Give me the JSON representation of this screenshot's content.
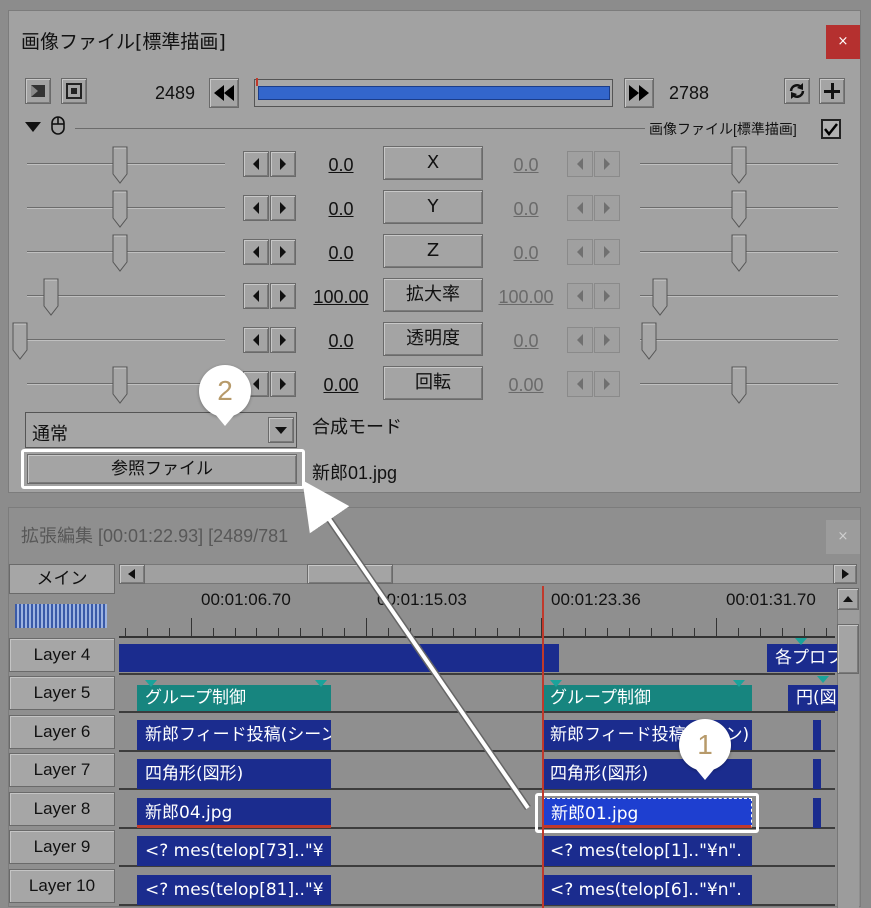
{
  "top_window": {
    "title": "画像ファイル[標準描画]",
    "close_label": "×",
    "frame_start": "2489",
    "frame_end": "2788",
    "object_label": "画像ファイル[標準描画]",
    "params": [
      {
        "name": "X",
        "value": "0.0",
        "end_value": "0.0"
      },
      {
        "name": "Y",
        "value": "0.0",
        "end_value": "0.0"
      },
      {
        "name": "Z",
        "value": "0.0",
        "end_value": "0.0"
      },
      {
        "name": "拡大率",
        "value": "100.00",
        "end_value": "100.00"
      },
      {
        "name": "透明度",
        "value": "0.0",
        "end_value": "0.0"
      },
      {
        "name": "回転",
        "value": "0.00",
        "end_value": "0.00"
      }
    ],
    "blend_mode_value": "通常",
    "blend_mode_label": "合成モード",
    "browse_button": "参照ファイル",
    "file_name": "新郎01.jpg"
  },
  "bottom_window": {
    "title": "拡張編集 [00:01:22.93] [2489/781",
    "close_label": "×",
    "scene_button": "メイン",
    "timestamps": [
      "00:01:06.70",
      "00:01:15.03",
      "00:01:23.36",
      "00:01:31.70"
    ],
    "layers": [
      "Layer 4",
      "Layer 5",
      "Layer 6",
      "Layer 7",
      "Layer 8",
      "Layer 9",
      "Layer 10"
    ],
    "clips": {
      "l4_right": "各プロフ",
      "l5_a": "グループ制御",
      "l5_b": "グループ制御",
      "l5_c": "円(図",
      "l6_a": "新郎フィード投稿(シーン",
      "l6_b": "新郎フィード投稿(シーン)",
      "l7_a": "四角形(図形)",
      "l7_b": "四角形(図形)",
      "l8_a": "新郎04.jpg",
      "l8_b": "新郎01.jpg",
      "l9_a": "<? mes(telop[73]..\"¥",
      "l9_b": "<? mes(telop[1]..\"¥n\".",
      "l10_a": "<? mes(telop[81]..\"¥",
      "l10_b": "<? mes(telop[6]..\"¥n\"."
    }
  },
  "annotations": {
    "callout_1": "1",
    "callout_2": "2"
  },
  "colors": {
    "clip_blue": "#1b2c8e",
    "clip_teal": "#17857f",
    "cursor_red": "#c0392b",
    "callout_text": "#b79a6a",
    "close_red": "#b5302f"
  }
}
